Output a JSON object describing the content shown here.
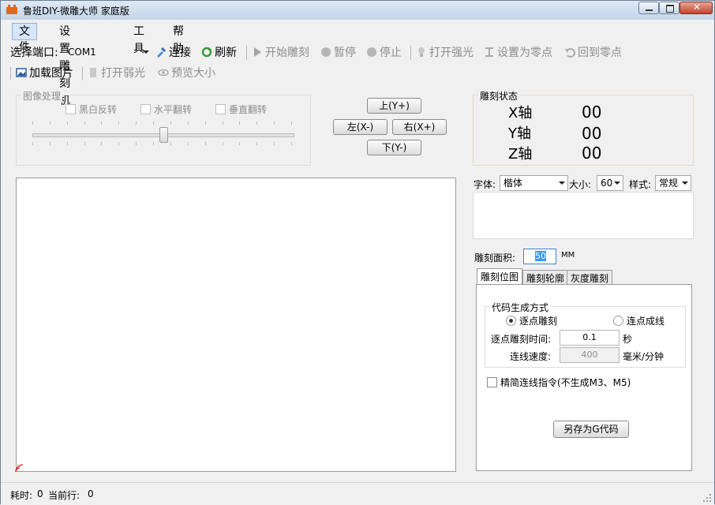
{
  "window": {
    "title": "鲁班DIY-微雕大师 家庭版"
  },
  "menu": [
    {
      "label": "文件"
    },
    {
      "label": "设置雕刻机"
    },
    {
      "label": "工具"
    },
    {
      "label": "帮助"
    }
  ],
  "toolbar1": {
    "port_label": "选择端口:",
    "port_value": "COM1",
    "connect": "连接",
    "refresh": "刷新",
    "start": "开始雕刻",
    "pause": "暂停",
    "stop": "停止",
    "strong_light": "打开强光",
    "set_zero": "设置为零点",
    "return_zero": "回到零点"
  },
  "toolbar2": {
    "load_image": "加载图片",
    "weak_light": "打开弱光",
    "preview_size": "预览大小"
  },
  "image_processing": {
    "caption": "图像处理",
    "invert": "黑白反转",
    "hflip": "水平翻转",
    "vflip": "垂直翻转",
    "slider_value": 0.5
  },
  "jog": {
    "up": "上(Y+)",
    "left": "左(X-)",
    "right": "右(X+)",
    "down": "下(Y-)"
  },
  "engrave_status": {
    "caption": "雕刻状态",
    "x_label": "X轴",
    "x_value": "00",
    "y_label": "Y轴",
    "y_value": "00",
    "z_label": "Z轴",
    "z_value": "00"
  },
  "font": {
    "font_label": "字体:",
    "font_value": "楷体",
    "size_label": "大小:",
    "size_value": "60",
    "style_label": "样式:",
    "style_value": "常规"
  },
  "area": {
    "label": "雕刻面积:",
    "value": "50",
    "unit": "MM"
  },
  "tabs": [
    {
      "label": "雕刻位图"
    },
    {
      "label": "雕刻轮廓"
    },
    {
      "label": "灰度雕刻"
    }
  ],
  "code_gen": {
    "caption": "代码生成方式",
    "option1": "逐点雕刻",
    "option2": "连点成线",
    "time_label": "逐点雕刻时间:",
    "time_value": "0.1",
    "time_unit": "秒",
    "speed_label": "连线速度:",
    "speed_value": "400",
    "speed_unit": "毫米/分钟",
    "simplify": "精简连线指令(不生成M3、M5)",
    "save_button": "另存为G代码"
  },
  "status": {
    "time_label": "耗时:",
    "time_value": "0",
    "line_label": "当前行:",
    "line_value": "0"
  }
}
